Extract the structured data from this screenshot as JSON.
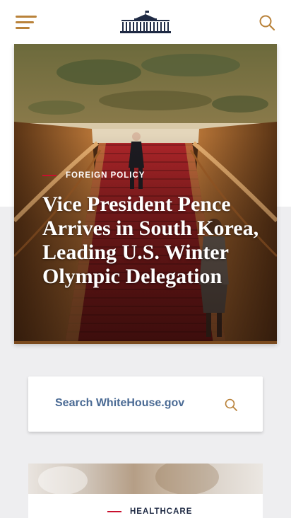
{
  "header": {
    "menu_icon": "hamburger-menu-icon",
    "logo": "white-house-logo",
    "search_icon": "search-icon"
  },
  "hero": {
    "category": "FOREIGN POLICY",
    "title": "Vice President Pence Arrives in South Korea, Leading U.S. Winter Olympic Delegation"
  },
  "search": {
    "placeholder": "Search WhiteHouse.gov",
    "icon": "search-icon"
  },
  "card": {
    "category": "HEALTHCARE"
  },
  "colors": {
    "accent_red": "#c8102e",
    "gold": "#b9823a",
    "navy": "#1f2a44",
    "search_text": "#4a6a94",
    "gray_band": "#eeeef0"
  }
}
